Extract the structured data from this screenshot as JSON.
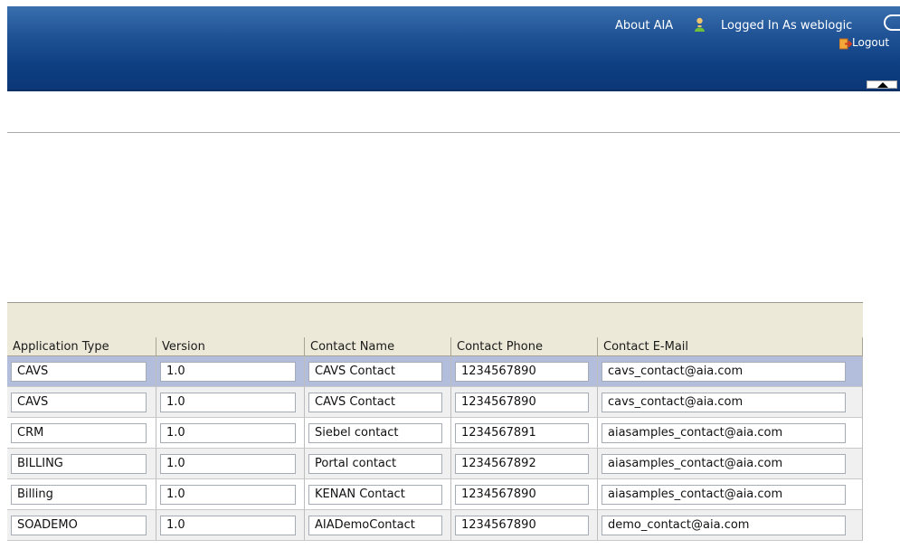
{
  "header": {
    "about_label": "About AIA",
    "logged_in_label": "Logged In As",
    "username": "weblogic",
    "logout_label": "Logout",
    "user_icon": "user-icon",
    "help_icon": "help-icon",
    "logout_icon": "logout-icon",
    "collapse_icon": "collapse-up-icon",
    "banner_color": "#1f5396"
  },
  "table": {
    "columns": [
      "Application Type",
      "Version",
      "Contact Name",
      "Contact Phone",
      "Contact E-Mail"
    ],
    "rows": [
      [
        "CAVS",
        "1.0",
        "CAVS Contact",
        "1234567890",
        "cavs_contact@aia.com"
      ],
      [
        "CAVS",
        "1.0",
        "CAVS Contact",
        "1234567890",
        "cavs_contact@aia.com"
      ],
      [
        "CRM",
        "1.0",
        "Siebel contact",
        "1234567891",
        "aiasamples_contact@aia.com"
      ],
      [
        "BILLING",
        "1.0",
        "Portal contact",
        "1234567892",
        "aiasamples_contact@aia.com"
      ],
      [
        "Billing",
        "1.0",
        "KENAN Contact",
        "1234567890",
        "aiasamples_contact@aia.com"
      ],
      [
        "SOADEMO",
        "1.0",
        "AIADemoContact",
        "1234567890",
        "demo_contact@aia.com"
      ]
    ],
    "selected_row_index": 0,
    "selected_row_color": "#b2bedb"
  }
}
